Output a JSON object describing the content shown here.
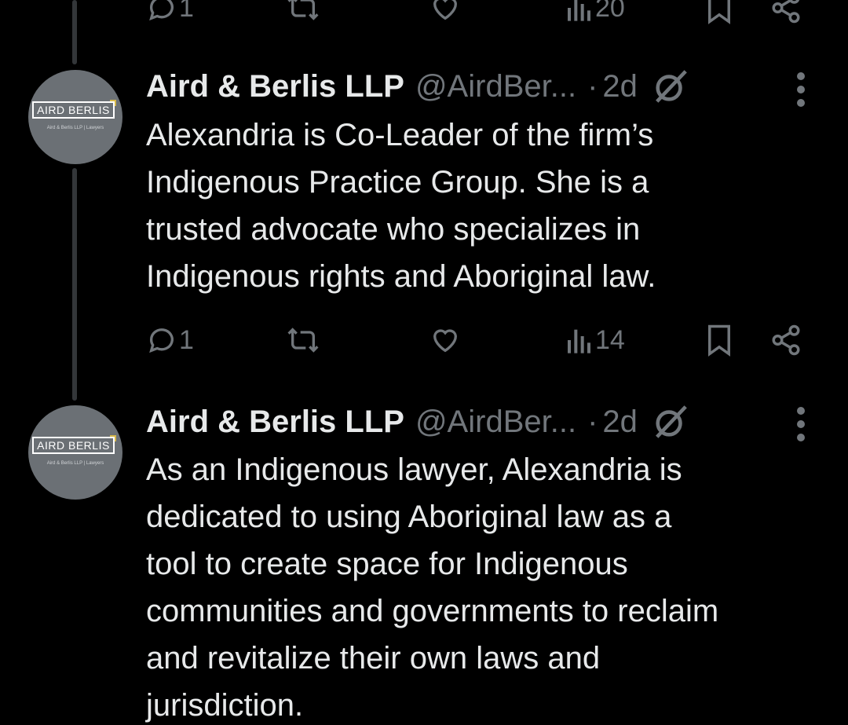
{
  "previous_tweet": {
    "actions": {
      "reply_count": "1",
      "views_count": "20"
    }
  },
  "tweets": [
    {
      "author_name": "Aird & Berlis LLP",
      "author_handle": "@AirdBer...",
      "separator": "·",
      "time_ago": "2d",
      "avatar": {
        "logo_text": "AIRD BERLIS",
        "logo_subtext": "Aird & Berlis LLP | Lawyers"
      },
      "body_lines": [
        "Alexandria is Co-Leader of the firm’s",
        "Indigenous Practice Group. She is a",
        "trusted advocate who specializes in",
        "Indigenous rights and Aboriginal law."
      ],
      "actions": {
        "reply_count": "1",
        "retweet_count": "",
        "like_count": "",
        "views_count": "14"
      }
    },
    {
      "author_name": "Aird & Berlis LLP",
      "author_handle": "@AirdBer...",
      "separator": "·",
      "time_ago": "2d",
      "avatar": {
        "logo_text": "AIRD BERLIS",
        "logo_subtext": "Aird & Berlis LLP | Lawyers"
      },
      "body_lines": [
        "As an Indigenous lawyer, Alexandria is",
        "dedicated to using Aboriginal law as a",
        "tool to create space for Indigenous",
        "communities and governments to reclaim",
        "and revitalize their own laws and",
        "jurisdiction."
      ]
    }
  ],
  "icons": {
    "reply": "reply-icon",
    "retweet": "retweet-icon",
    "like": "like-icon",
    "views": "views-icon",
    "bookmark": "bookmark-icon",
    "share": "share-icon",
    "grok": "grok-icon",
    "more": "more-icon"
  },
  "colors": {
    "background": "#000000",
    "text": "#e7e9ea",
    "muted": "#71767b",
    "thread_line": "#333639",
    "avatar_bg": "#6b7075"
  }
}
